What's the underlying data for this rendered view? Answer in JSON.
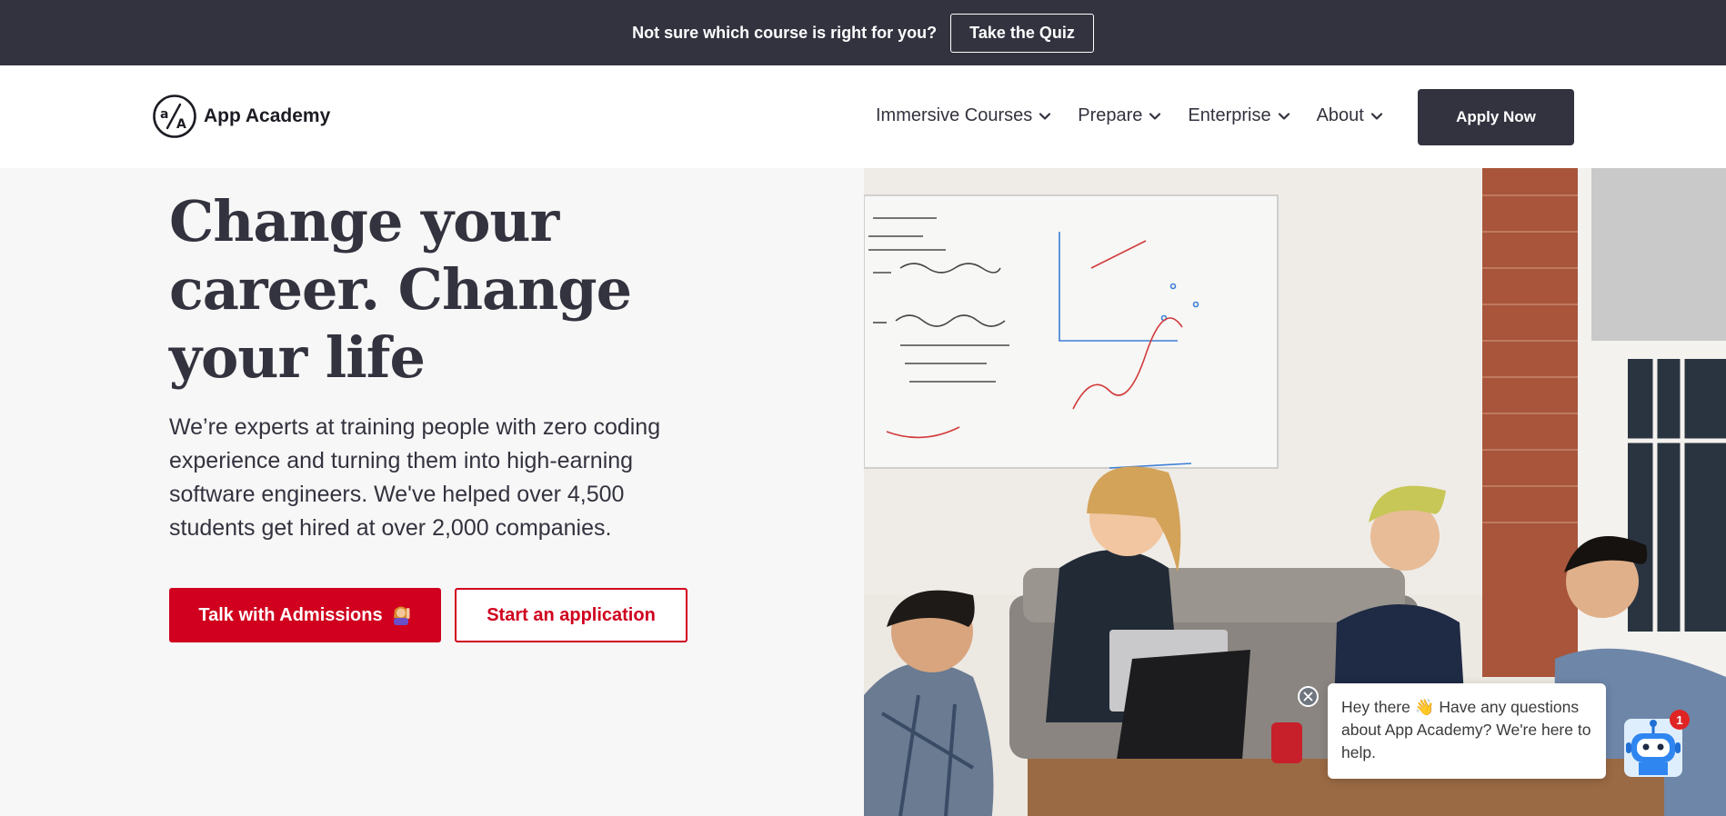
{
  "announcement": {
    "text": "Not sure which course is right for you?",
    "quiz_label": "Take the Quiz"
  },
  "header": {
    "logo_text": "App Academy",
    "nav": [
      {
        "label": "Immersive Courses",
        "icon": "chevron-down-icon"
      },
      {
        "label": "Prepare",
        "icon": "chevron-down-icon"
      },
      {
        "label": "Enterprise",
        "icon": "chevron-down-icon"
      },
      {
        "label": "About",
        "icon": "chevron-down-icon"
      }
    ],
    "apply_label": "Apply Now"
  },
  "hero": {
    "title": "Change your career. Change your life",
    "description": "We’re experts at training people with zero coding experience and turning them into high-earning software engineers. We've helped over 4,500 students get hired at over 2,000 companies.",
    "primary_cta": "Talk with Admissions",
    "primary_cta_icon": "woman-raising-hand-icon",
    "secondary_cta": "Start an application"
  },
  "chat": {
    "message": "Hey there 👋 Have any questions about App Academy? We're here to help.",
    "badge_count": "1",
    "avatar_icon": "robot-icon"
  },
  "colors": {
    "dark": "#333340",
    "accent_red": "#d0001e",
    "hero_bg": "#f7f7f7"
  }
}
